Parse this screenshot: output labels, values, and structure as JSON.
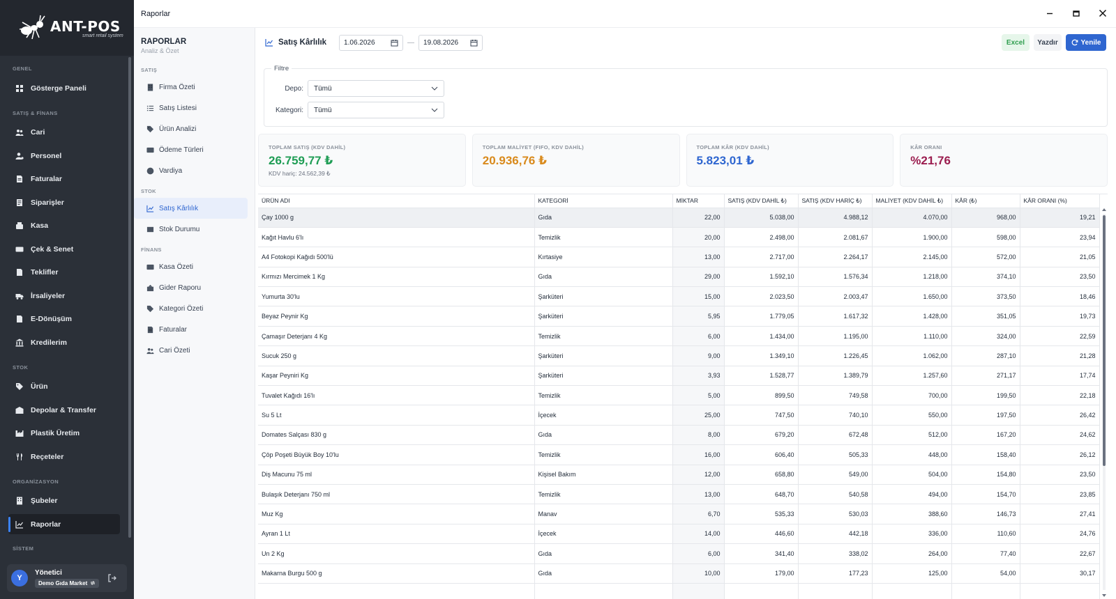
{
  "brand": {
    "name": "ANT-POS",
    "tagline": "smart retail system"
  },
  "window": {
    "title": "Raporlar"
  },
  "sidebar": {
    "sections": [
      {
        "title": "GENEL",
        "items": [
          {
            "label": "Gösterge Paneli",
            "icon": "grid-icon"
          }
        ]
      },
      {
        "title": "SATIŞ & FİNANS",
        "items": [
          {
            "label": "Cari",
            "icon": "users-icon"
          },
          {
            "label": "Personel",
            "icon": "user-gear-icon"
          },
          {
            "label": "Faturalar",
            "icon": "invoice-icon"
          },
          {
            "label": "Siparişler",
            "icon": "order-icon"
          },
          {
            "label": "Kasa",
            "icon": "cashbox-icon"
          },
          {
            "label": "Çek & Senet",
            "icon": "cheque-icon"
          },
          {
            "label": "Teklifler",
            "icon": "offer-icon"
          },
          {
            "label": "İrsaliyeler",
            "icon": "truck-icon"
          },
          {
            "label": "E-Dönüşüm",
            "icon": "e-document-icon"
          },
          {
            "label": "Kredilerim",
            "icon": "bank-icon"
          }
        ]
      },
      {
        "title": "STOK",
        "items": [
          {
            "label": "Ürün",
            "icon": "tag-icon"
          },
          {
            "label": "Depolar & Transfer",
            "icon": "warehouse-icon"
          },
          {
            "label": "Plastik Üretim",
            "icon": "factory-icon"
          },
          {
            "label": "Reçeteler",
            "icon": "utensils-icon"
          }
        ]
      },
      {
        "title": "ORGANİZASYON",
        "items": [
          {
            "label": "Şubeler",
            "icon": "building-icon"
          },
          {
            "label": "Raporlar",
            "icon": "chart-line-icon",
            "active": true
          }
        ]
      },
      {
        "title": "SİSTEM",
        "items": []
      }
    ]
  },
  "user": {
    "initial": "Y",
    "name": "Yönetici",
    "store": "Demo Gıda Market"
  },
  "subnav": {
    "title": "RAPORLAR",
    "subtitle": "Analiz & Özet",
    "sections": [
      {
        "title": "SATIŞ",
        "items": [
          {
            "label": "Firma Özeti",
            "icon": "building-icon"
          },
          {
            "label": "Satış Listesi",
            "icon": "list-icon"
          },
          {
            "label": "Ürün Analizi",
            "icon": "tag-icon"
          },
          {
            "label": "Ödeme Türleri",
            "icon": "card-icon"
          },
          {
            "label": "Vardiya",
            "icon": "clock-icon"
          }
        ]
      },
      {
        "title": "STOK",
        "items": [
          {
            "label": "Satış Kârlılık",
            "icon": "chart-line-icon",
            "active": true
          },
          {
            "label": "Stok Durumu",
            "icon": "box-icon"
          }
        ]
      },
      {
        "title": "FİNANS",
        "items": [
          {
            "label": "Kasa Özeti",
            "icon": "wallet-icon"
          },
          {
            "label": "Gider Raporu",
            "icon": "expense-icon"
          },
          {
            "label": "Kategori Özeti",
            "icon": "tags-icon"
          },
          {
            "label": "Faturalar",
            "icon": "invoice-icon"
          },
          {
            "label": "Cari Özeti",
            "icon": "users-icon"
          }
        ]
      }
    ]
  },
  "toolbar": {
    "title": "Satış Kârlılık",
    "date_from": "1.06.2026",
    "date_to": "19.08.2026",
    "date_sep": "—",
    "excel": "Excel",
    "print": "Yazdır",
    "refresh": "Yenile"
  },
  "filter": {
    "legend": "Filtre",
    "depo_label": "Depo:",
    "depo_value": "Tümü",
    "kategori_label": "Kategori:",
    "kategori_value": "Tümü"
  },
  "cards": [
    {
      "label": "TOPLAM SATIŞ (KDV DAHİL)",
      "value": "26.759,77 ₺",
      "sub": "KDV hariç: 24.562,39 ₺",
      "color": "#1f9d55"
    },
    {
      "label": "TOPLAM MALİYET (FIFO, KDV DAHİL)",
      "value": "20.936,76 ₺",
      "sub": "",
      "color": "#d98a1c"
    },
    {
      "label": "TOPLAM KÂR (KDV DAHİL)",
      "value": "5.823,01 ₺",
      "sub": "",
      "color": "#2f66d0"
    },
    {
      "label": "KÂR ORANI",
      "value": "%21,76",
      "sub": "",
      "color": "#9b1d4f"
    }
  ],
  "table": {
    "columns": [
      "ÜRÜN ADI",
      "KATEGORİ",
      "MİKTAR",
      "SATIŞ (KDV DAHİL ₺)",
      "SATIŞ (KDV HARİÇ ₺)",
      "MALİYET (KDV DAHİL ₺)",
      "KÂR (₺)",
      "KÂR ORANI (%)"
    ],
    "rows": [
      [
        "Çay 1000 g",
        "Gıda",
        "22,00",
        "5.038,00",
        "4.988,12",
        "4.070,00",
        "968,00",
        "19,21"
      ],
      [
        "Kağıt Havlu 6'lı",
        "Temizlik",
        "20,00",
        "2.498,00",
        "2.081,67",
        "1.900,00",
        "598,00",
        "23,94"
      ],
      [
        "A4 Fotokopi Kağıdı 500'lü",
        "Kırtasiye",
        "13,00",
        "2.717,00",
        "2.264,17",
        "2.145,00",
        "572,00",
        "21,05"
      ],
      [
        "Kırmızı Mercimek 1 Kg",
        "Gıda",
        "29,00",
        "1.592,10",
        "1.576,34",
        "1.218,00",
        "374,10",
        "23,50"
      ],
      [
        "Yumurta 30'lu",
        "Şarküteri",
        "15,00",
        "2.023,50",
        "2.003,47",
        "1.650,00",
        "373,50",
        "18,46"
      ],
      [
        "Beyaz Peynir Kg",
        "Şarküteri",
        "5,95",
        "1.779,05",
        "1.617,32",
        "1.428,00",
        "351,05",
        "19,73"
      ],
      [
        "Çamaşır Deterjanı 4 Kg",
        "Temizlik",
        "6,00",
        "1.434,00",
        "1.195,00",
        "1.110,00",
        "324,00",
        "22,59"
      ],
      [
        "Sucuk 250 g",
        "Şarküteri",
        "9,00",
        "1.349,10",
        "1.226,45",
        "1.062,00",
        "287,10",
        "21,28"
      ],
      [
        "Kaşar Peyniri Kg",
        "Şarküteri",
        "3,93",
        "1.528,77",
        "1.389,79",
        "1.257,60",
        "271,17",
        "17,74"
      ],
      [
        "Tuvalet Kağıdı 16'lı",
        "Temizlik",
        "5,00",
        "899,50",
        "749,58",
        "700,00",
        "199,50",
        "22,18"
      ],
      [
        "Su 5 Lt",
        "İçecek",
        "25,00",
        "747,50",
        "740,10",
        "550,00",
        "197,50",
        "26,42"
      ],
      [
        "Domates Salçası 830 g",
        "Gıda",
        "8,00",
        "679,20",
        "672,48",
        "512,00",
        "167,20",
        "24,62"
      ],
      [
        "Çöp Poşeti Büyük Boy 10'lu",
        "Temizlik",
        "16,00",
        "606,40",
        "505,33",
        "448,00",
        "158,40",
        "26,12"
      ],
      [
        "Diş Macunu 75 ml",
        "Kişisel Bakım",
        "12,00",
        "658,80",
        "549,00",
        "504,00",
        "154,80",
        "23,50"
      ],
      [
        "Bulaşık Deterjanı 750 ml",
        "Temizlik",
        "13,00",
        "648,70",
        "540,58",
        "494,00",
        "154,70",
        "23,85"
      ],
      [
        "Muz Kg",
        "Manav",
        "6,70",
        "535,33",
        "530,03",
        "388,60",
        "146,73",
        "27,41"
      ],
      [
        "Ayran 1 Lt",
        "İçecek",
        "14,00",
        "446,60",
        "442,18",
        "336,00",
        "110,60",
        "24,76"
      ],
      [
        "Un 2 Kg",
        "Gıda",
        "6,00",
        "341,40",
        "338,02",
        "264,00",
        "77,40",
        "22,67"
      ],
      [
        "Makarna Burgu 500 g",
        "Gıda",
        "10,00",
        "179,00",
        "177,23",
        "125,00",
        "54,00",
        "30,17"
      ],
      [
        "",
        "",
        "",
        "",
        "",
        "",
        "",
        ""
      ]
    ]
  },
  "colors": {
    "accent": "#2f66d0",
    "sidebar": "#2b3038"
  }
}
